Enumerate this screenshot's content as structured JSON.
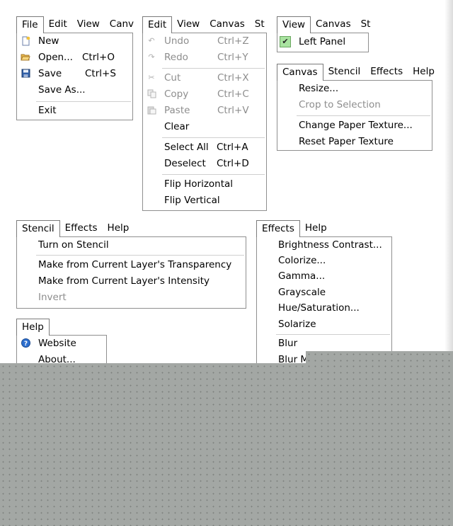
{
  "file_menu": {
    "bar": [
      "File",
      "Edit",
      "View",
      "Canv"
    ],
    "items": [
      {
        "label": "New",
        "shortcut": "",
        "icon": "new-document-icon"
      },
      {
        "label": "Open...",
        "shortcut": "Ctrl+O",
        "icon": "open-folder-icon"
      },
      {
        "label": "Save",
        "shortcut": "Ctrl+S",
        "icon": "save-disk-icon"
      },
      {
        "label": "Save As...",
        "shortcut": ""
      },
      {
        "label": "Exit",
        "shortcut": ""
      }
    ]
  },
  "edit_menu": {
    "bar": [
      "Edit",
      "View",
      "Canvas",
      "St"
    ],
    "items": [
      {
        "label": "Undo",
        "shortcut": "Ctrl+Z",
        "icon": "undo-icon"
      },
      {
        "label": "Redo",
        "shortcut": "Ctrl+Y",
        "icon": "redo-icon"
      },
      {
        "label": "Cut",
        "shortcut": "Ctrl+X",
        "icon": "cut-icon"
      },
      {
        "label": "Copy",
        "shortcut": "Ctrl+C",
        "icon": "copy-icon"
      },
      {
        "label": "Paste",
        "shortcut": "Ctrl+V",
        "icon": "paste-icon"
      },
      {
        "label": "Clear",
        "shortcut": ""
      },
      {
        "label": "Select All",
        "shortcut": "Ctrl+A"
      },
      {
        "label": "Deselect",
        "shortcut": "Ctrl+D"
      },
      {
        "label": "Flip Horizontal",
        "shortcut": ""
      },
      {
        "label": "Flip Vertical",
        "shortcut": ""
      }
    ]
  },
  "view_menu": {
    "bar": [
      "View",
      "Canvas",
      "St"
    ],
    "items": [
      {
        "label": "Left Panel",
        "checked": true
      }
    ]
  },
  "canvas_menu": {
    "bar": [
      "Canvas",
      "Stencil",
      "Effects",
      "Help"
    ],
    "items": [
      {
        "label": "Resize..."
      },
      {
        "label": "Crop to Selection"
      },
      {
        "label": "Change Paper Texture..."
      },
      {
        "label": "Reset Paper Texture"
      }
    ]
  },
  "stencil_menu": {
    "bar": [
      "Stencil",
      "Effects",
      "Help"
    ],
    "items": [
      {
        "label": "Turn on Stencil"
      },
      {
        "label": "Make from Current Layer's Transparency"
      },
      {
        "label": "Make from Current Layer's Intensity"
      },
      {
        "label": "Invert"
      }
    ]
  },
  "effects_menu": {
    "bar": [
      "Effects",
      "Help"
    ],
    "items": [
      {
        "label": "Brightness Contrast..."
      },
      {
        "label": "Colorize..."
      },
      {
        "label": "Gamma..."
      },
      {
        "label": "Grayscale"
      },
      {
        "label": "Hue/Saturation..."
      },
      {
        "label": "Solarize"
      },
      {
        "label": "Blur"
      },
      {
        "label": "Blur Mo"
      }
    ]
  },
  "help_menu": {
    "bar": [
      "Help"
    ],
    "items": [
      {
        "label": "Website",
        "icon": "help-question-icon"
      },
      {
        "label": "About..."
      }
    ]
  },
  "colors": {
    "menu_border": "#8f8f8f",
    "disabled_text": "#8d8d8d",
    "check_bg": "#a9e3a0",
    "overlay_gray": "#a3a7a4"
  }
}
